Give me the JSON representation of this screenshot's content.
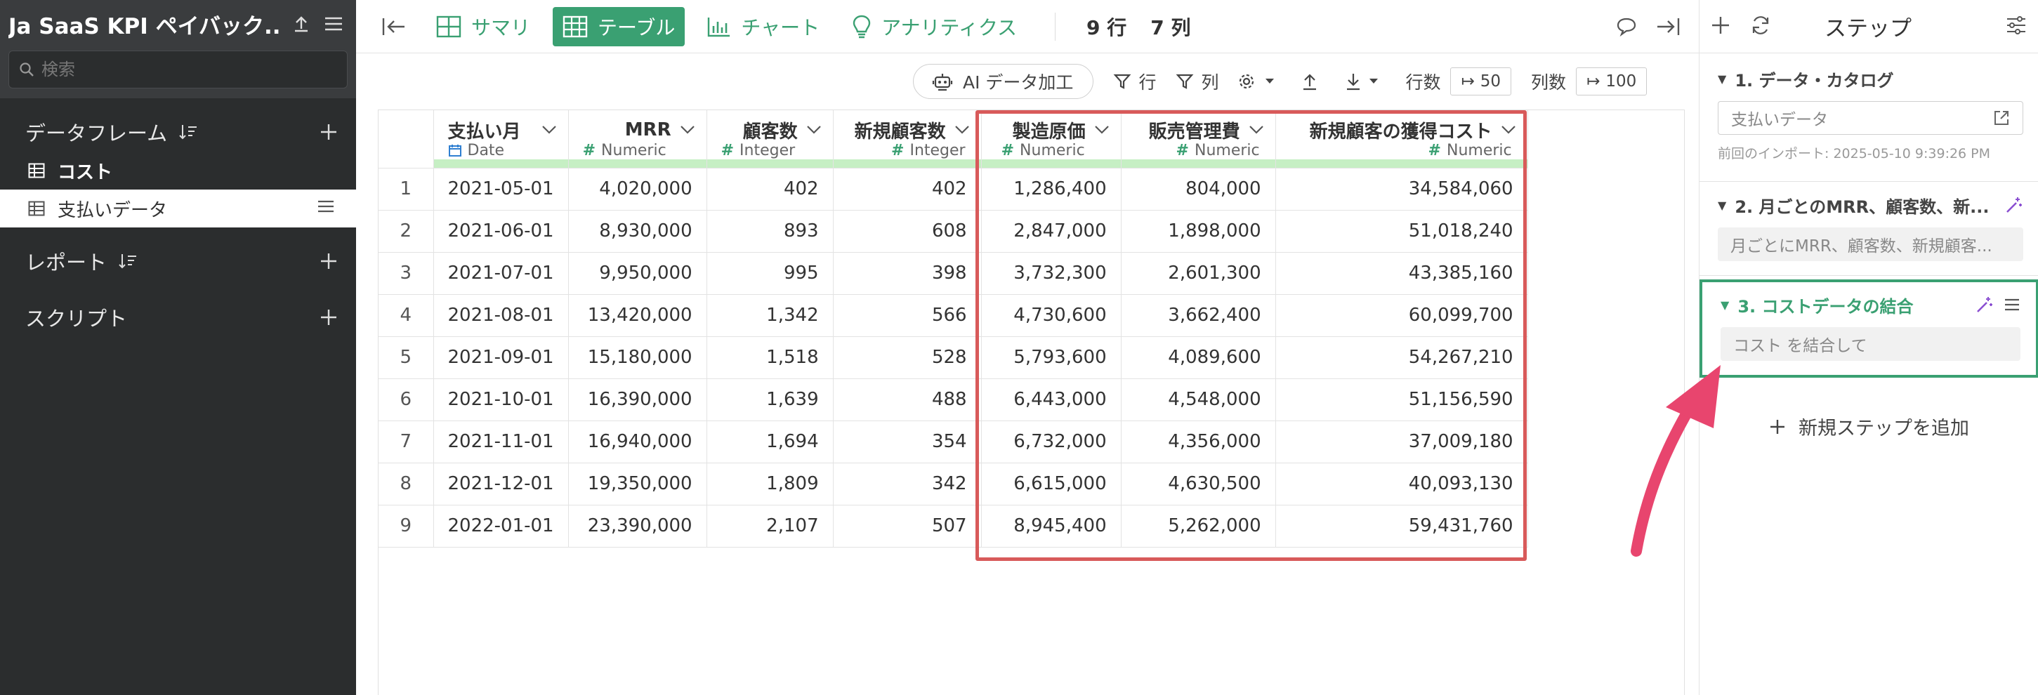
{
  "sidebar": {
    "title": "Ja SaaS KPI ペイバック...",
    "search_placeholder": "検索",
    "dataframes_label": "データフレーム",
    "items": [
      {
        "label": "コスト",
        "bold": true
      },
      {
        "label": "支払いデータ",
        "selected": true
      }
    ],
    "reports_label": "レポート",
    "scripts_label": "スクリプト"
  },
  "toolbar": {
    "tabs": [
      {
        "label": "サマリ",
        "icon": "summary-grid-icon"
      },
      {
        "label": "テーブル",
        "icon": "table-icon",
        "active": true
      },
      {
        "label": "チャート",
        "icon": "bar-chart-icon"
      },
      {
        "label": "アナリティクス",
        "icon": "lightbulb-icon"
      }
    ],
    "row_count": "9 行",
    "col_count": "7 列"
  },
  "subbar": {
    "ai_label": "AI データ加工",
    "row_filter": "行",
    "col_filter": "列",
    "rows_label": "行数",
    "rows_value": "50",
    "cols_label": "列数",
    "cols_value": "100"
  },
  "table": {
    "columns": [
      {
        "name": "支払い月",
        "type": "Date"
      },
      {
        "name": "MRR",
        "type": "Numeric"
      },
      {
        "name": "顧客数",
        "type": "Integer"
      },
      {
        "name": "新規顧客数",
        "type": "Integer"
      },
      {
        "name": "製造原価",
        "type": "Numeric"
      },
      {
        "name": "販売管理費",
        "type": "Numeric"
      },
      {
        "name": "新規顧客の獲得コスト",
        "type": "Numeric"
      }
    ],
    "rows": [
      [
        "1",
        "2021-05-01",
        "4,020,000",
        "402",
        "402",
        "1,286,400",
        "804,000",
        "34,584,060"
      ],
      [
        "2",
        "2021-06-01",
        "8,930,000",
        "893",
        "608",
        "2,847,000",
        "1,898,000",
        "51,018,240"
      ],
      [
        "3",
        "2021-07-01",
        "9,950,000",
        "995",
        "398",
        "3,732,300",
        "2,601,300",
        "43,385,160"
      ],
      [
        "4",
        "2021-08-01",
        "13,420,000",
        "1,342",
        "566",
        "4,730,600",
        "3,662,400",
        "60,099,700"
      ],
      [
        "5",
        "2021-09-01",
        "15,180,000",
        "1,518",
        "528",
        "5,793,600",
        "4,089,600",
        "54,267,210"
      ],
      [
        "6",
        "2021-10-01",
        "16,390,000",
        "1,639",
        "488",
        "6,443,000",
        "4,548,000",
        "51,156,590"
      ],
      [
        "7",
        "2021-11-01",
        "16,940,000",
        "1,694",
        "354",
        "6,732,000",
        "4,356,000",
        "37,009,180"
      ],
      [
        "8",
        "2021-12-01",
        "19,350,000",
        "1,809",
        "342",
        "6,615,000",
        "4,630,500",
        "40,093,130"
      ],
      [
        "9",
        "2022-01-01",
        "23,390,000",
        "2,107",
        "507",
        "8,945,400",
        "5,262,000",
        "59,431,760"
      ]
    ]
  },
  "steps_panel": {
    "title": "ステップ",
    "steps": [
      {
        "title": "1. データ・カタログ",
        "box": "支払いデータ",
        "meta": "前回のインポート: 2025-05-10 9:39:26 PM"
      },
      {
        "title": "2. 月ごとのMRR、顧客数、新...",
        "box": "月ごとにMRR、顧客数、新規顧客..."
      },
      {
        "title": "3. コストデータの結合",
        "box": "コスト を結合して"
      }
    ],
    "add_step": "新規ステップを追加"
  },
  "colors": {
    "accent": "#3aa072",
    "highlight": "#d85a5a",
    "arrow": "#e8456e",
    "sidebar_bg": "#2b2d2e"
  }
}
